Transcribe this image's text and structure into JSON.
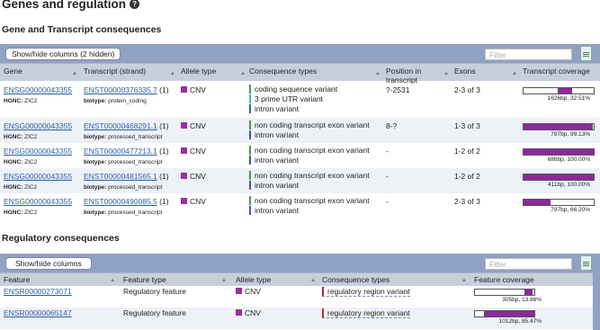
{
  "page_title": "Genes and regulation",
  "transcript_section": {
    "title": "Gene and Transcript consequences",
    "button_label": "Show/hide columns (2 hidden)",
    "filter_placeholder": "Filter",
    "columns": [
      "Gene",
      "Transcript (strand)",
      "Allele type",
      "Consequence types",
      "Position in transcript",
      "Exons",
      "Transcript coverage"
    ],
    "rows": [
      {
        "gene": "ENSG00000043355",
        "hgnc_label": "HGNC:",
        "hgnc": "ZIC2",
        "transcript": "ENST00000376335.7",
        "strand": "(1)",
        "biotype_label": "biotype:",
        "biotype": "protein_coding",
        "allele": "CNV",
        "consequences": [
          "coding sequence variant",
          "3 prime UTR variant",
          "intron variant"
        ],
        "position": "?-2531",
        "exons": "2-3 of 3",
        "coverage_fraction": 0.3251,
        "coverage_label": "1626bp, 32.51%"
      },
      {
        "gene": "ENSG00000043355",
        "hgnc_label": "HGNC:",
        "hgnc": "ZIC2",
        "transcript": "ENST00000468291.1",
        "strand": "(1)",
        "biotype_label": "biotype:",
        "biotype": "processed_transcript",
        "allele": "CNV",
        "consequences": [
          "non coding transcript exon variant",
          "intron variant"
        ],
        "position": "8-?",
        "exons": "1-3 of 3",
        "coverage_fraction": 0.9913,
        "coverage_label": "797bp, 99.13%"
      },
      {
        "gene": "ENSG00000043355",
        "hgnc_label": "HGNC:",
        "hgnc": "ZIC2",
        "transcript": "ENST00000477213.1",
        "strand": "(1)",
        "biotype_label": "biotype:",
        "biotype": "processed_transcript",
        "allele": "CNV",
        "consequences": [
          "non coding transcript exon variant",
          "intron variant"
        ],
        "position": "-",
        "exons": "1-2 of 2",
        "coverage_fraction": 1.0,
        "coverage_label": "686bp, 100.00%"
      },
      {
        "gene": "ENSG00000043355",
        "hgnc_label": "HGNC:",
        "hgnc": "ZIC2",
        "transcript": "ENST00000481565.1",
        "strand": "(1)",
        "biotype_label": "biotype:",
        "biotype": "processed_transcript",
        "allele": "CNV",
        "consequences": [
          "non coding transcript exon variant",
          "intron variant"
        ],
        "position": "-",
        "exons": "1-2 of 2",
        "coverage_fraction": 1.0,
        "coverage_label": "411bp, 100.00%"
      },
      {
        "gene": "ENSG00000043355",
        "hgnc_label": "HGNC:",
        "hgnc": "ZIC2",
        "transcript": "ENST00000490085.5",
        "strand": "(1)",
        "biotype_label": "biotype:",
        "biotype": "processed_transcript",
        "allele": "CNV",
        "consequences": [
          "non coding transcript exon variant",
          "intron variant"
        ],
        "position": "-",
        "exons": "2-3 of 3",
        "coverage_fraction": 0.662,
        "coverage_label": "797bp, 66.20%"
      }
    ]
  },
  "regulatory_section": {
    "title": "Regulatory consequences",
    "button_label": "Show/hide columns",
    "filter_placeholder": "Filter",
    "columns": [
      "Feature",
      "Feature type",
      "Allele type",
      "Consequence types",
      "Feature coverage"
    ],
    "rows": [
      {
        "feature": "ENSR00000273071",
        "feature_type": "Regulatory feature",
        "allele": "CNV",
        "consequence": "regulatory region variant",
        "coverage_fraction": 0.1386,
        "coverage_label": "305bp, 13.86%"
      },
      {
        "feature": "ENSR00000065147",
        "feature_type": "Regulatory feature",
        "allele": "CNV",
        "consequence": "regulatory region variant",
        "coverage_fraction": 0.8547,
        "coverage_label": "1012bp, 85.47%"
      }
    ]
  },
  "colors": {
    "header_bar": "#8fa2c4",
    "column_header": "#c7cfdd",
    "cnv": "#9e2f9e",
    "coverage_fill": "#8b2a9b",
    "link": "#2b5fa8"
  }
}
